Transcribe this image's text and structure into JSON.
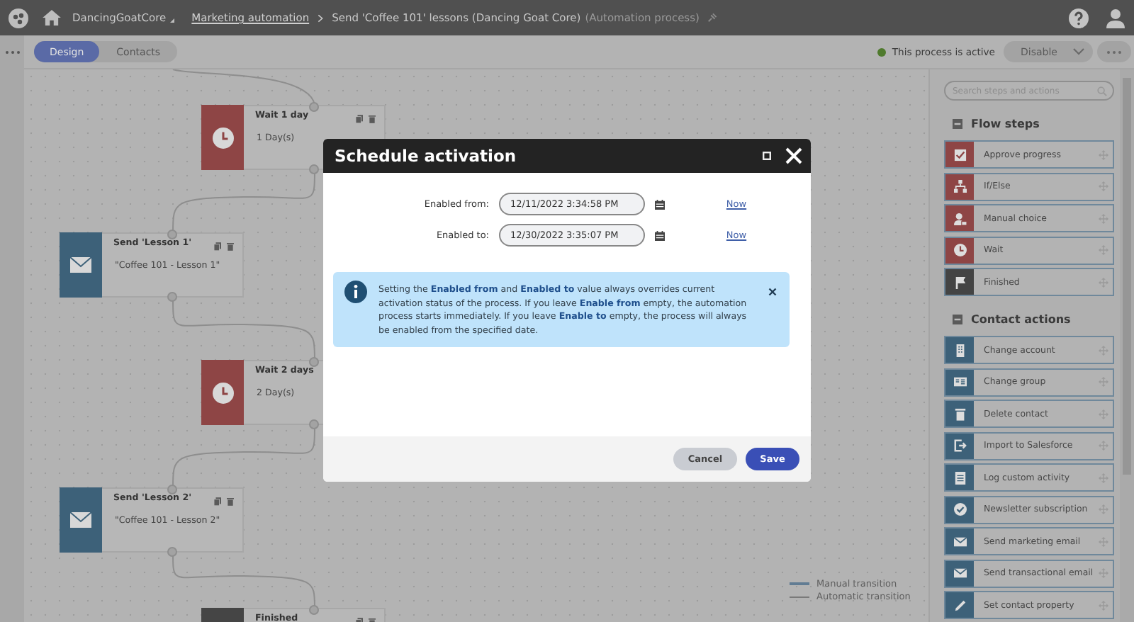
{
  "header": {
    "site": "DancingGoatCore",
    "section_link": "Marketing automation",
    "page": "Send 'Coffee 101' lessons (Dancing Goat Core)",
    "page_type": "(Automation process)"
  },
  "tabs": [
    {
      "label": "Design",
      "selected": true
    },
    {
      "label": "Contacts",
      "selected": false
    }
  ],
  "status": {
    "text": "This process is active",
    "active": true
  },
  "actions": {
    "disable": "Disable"
  },
  "nodes": [
    {
      "kind": "wait",
      "title": "Wait 1 day",
      "detail": "1 Day(s)"
    },
    {
      "kind": "email",
      "title": "Send 'Lesson 1'",
      "detail": "\"Coffee 101 - Lesson 1\""
    },
    {
      "kind": "wait",
      "title": "Wait 2 days",
      "detail": "2 Day(s)"
    },
    {
      "kind": "email",
      "title": "Send 'Lesson 2'",
      "detail": "\"Coffee 101 - Lesson 2\""
    },
    {
      "kind": "finished",
      "title": "Finished"
    }
  ],
  "legend": [
    "Manual transition",
    "Automatic transition"
  ],
  "panel": {
    "search": {
      "placeholder": "Search steps and actions"
    },
    "sections": [
      {
        "title": "Flow steps",
        "expanded": true,
        "items": [
          {
            "label": "Approve progress",
            "kind": "approve",
            "color": "#8e4545"
          },
          {
            "label": "If/Else",
            "kind": "ifelse",
            "color": "#8e4545"
          },
          {
            "label": "Manual choice",
            "kind": "manual",
            "color": "#8e4545"
          },
          {
            "label": "Wait",
            "kind": "wait",
            "color": "#8e4545"
          },
          {
            "label": "Finished",
            "kind": "finished",
            "color": "#444444"
          }
        ]
      },
      {
        "title": "Contact actions",
        "expanded": true,
        "items": [
          {
            "label": "Change account",
            "kind": "account",
            "color": "#3d6179"
          },
          {
            "label": "Change group",
            "kind": "group",
            "color": "#3d6179"
          },
          {
            "label": "Delete contact",
            "kind": "delete",
            "color": "#3d6179"
          },
          {
            "label": "Import to Salesforce",
            "kind": "import",
            "color": "#3d6179"
          },
          {
            "label": "Log custom activity",
            "kind": "log",
            "color": "#3d6179"
          },
          {
            "label": "Newsletter subscription",
            "kind": "newsletter",
            "color": "#3d6179"
          },
          {
            "label": "Send marketing email",
            "kind": "email",
            "color": "#3d6179"
          },
          {
            "label": "Send transactional email",
            "kind": "email",
            "color": "#3d6179"
          },
          {
            "label": "Set contact property",
            "kind": "property",
            "color": "#3d6179"
          }
        ]
      }
    ]
  },
  "dialog": {
    "title": "Schedule activation",
    "fields": [
      {
        "label": "Enabled from:",
        "value": "12/11/2022 3:34:58 PM",
        "link": "Now"
      },
      {
        "label": "Enabled to:",
        "value": "12/30/2022 3:35:07 PM",
        "link": "Now"
      }
    ],
    "info": "Setting the **Enabled from** and **Enabled to** value always overrides current activation status of the process. If you leave **Enable from** empty, the automation process starts immediately. If you leave **Enable to** empty, the process will always be enabled from the specified date.",
    "buttons": [
      {
        "label": "Cancel",
        "kind": "secondary"
      },
      {
        "label": "Save",
        "kind": "primary"
      }
    ]
  }
}
